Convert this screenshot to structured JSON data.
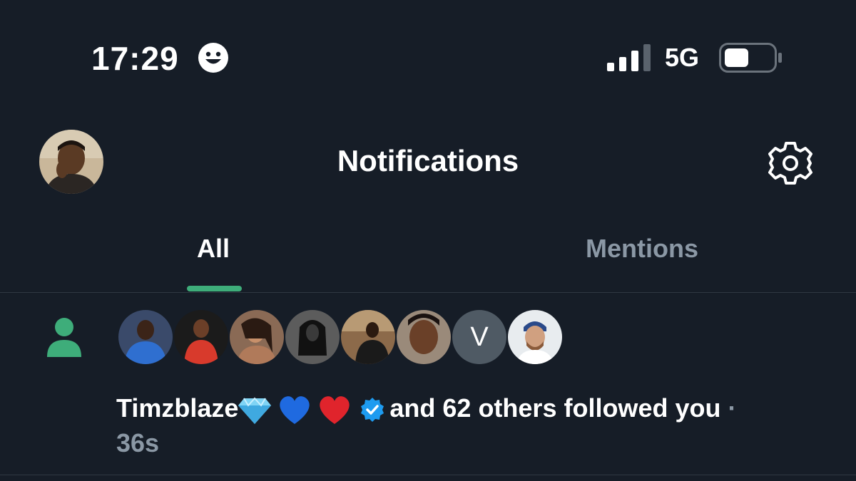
{
  "status_bar": {
    "time": "17:29",
    "network": "5G",
    "focus_icon": "smiley-face-icon",
    "signal_icon": "cellular-signal-icon",
    "battery_icon": "battery-icon"
  },
  "header": {
    "title": "Notifications",
    "profile_icon": "avatar",
    "settings_icon": "gear-icon"
  },
  "tabs": [
    {
      "label": "All",
      "active": true
    },
    {
      "label": "Mentions",
      "active": false
    }
  ],
  "notification": {
    "type_icon": "person-icon",
    "avatar_letter": "V",
    "username": "Timzblaze",
    "username_emojis": [
      "gem-icon",
      "blue-heart-icon",
      "red-heart-icon"
    ],
    "verified_icon": "verified-badge-icon",
    "message": "and 62 others followed you",
    "separator": "·",
    "time": "36s"
  },
  "colors": {
    "background": "#161d27",
    "accent": "#3ead7a",
    "muted_text": "#8b98a5",
    "verified_blue": "#1d9bf0",
    "divider": "#2f3842"
  }
}
